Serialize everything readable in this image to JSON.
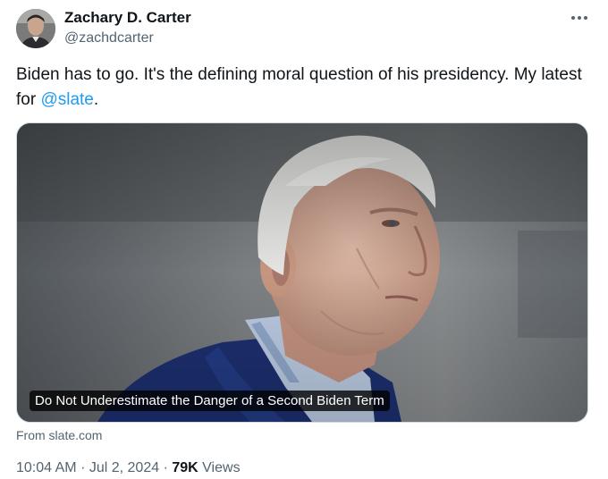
{
  "author": {
    "name": "Zachary D. Carter",
    "handle": "@zachdcarter"
  },
  "tweet": {
    "text_before": "Biden has to go. It's the defining moral question of his presidency. My latest for ",
    "mention": "@slate",
    "text_after": "."
  },
  "card": {
    "title": "Do Not Underestimate the Danger of a Second Biden Term",
    "source": "From slate.com"
  },
  "meta": {
    "time": "10:04 AM",
    "separator": "·",
    "date": "Jul 2, 2024",
    "views_count": "79K",
    "views_label": "Views"
  },
  "icons": {
    "more": "more-horizontal-icon"
  },
  "colors": {
    "accent": "#1d9bf0",
    "secondary_text": "#536471",
    "primary_text": "#0f1419",
    "border": "#cfd9de"
  }
}
